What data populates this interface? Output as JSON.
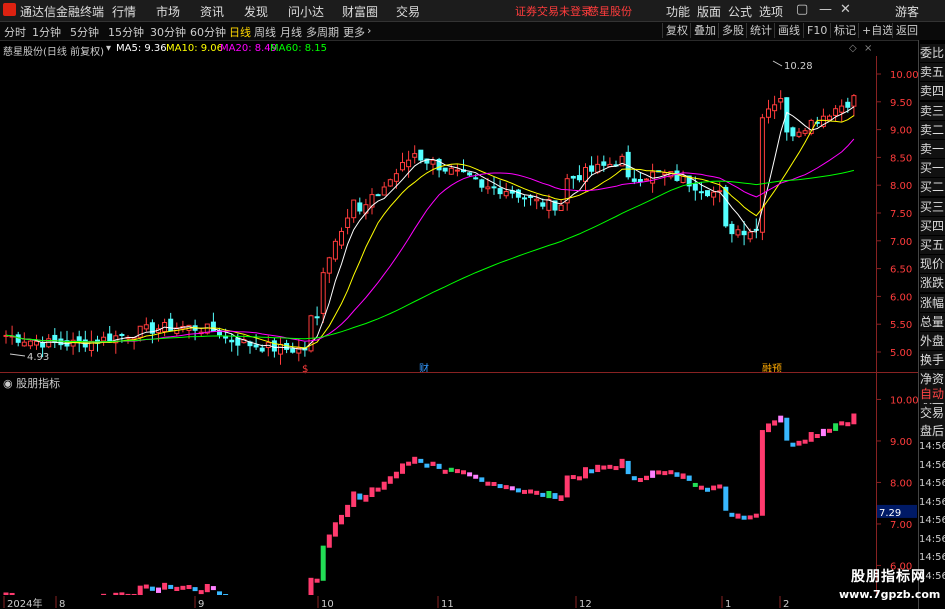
{
  "titlebar": {
    "app_name": "通达信金融终端",
    "menus": [
      "行情",
      "市场",
      "资讯",
      "发现",
      "问小达",
      "财富圈",
      "交易"
    ],
    "trade_notice": "证券交易未登录",
    "stock_name": "慈星股份",
    "right_menus": [
      "功能",
      "版面",
      "公式",
      "选项"
    ],
    "guest": "游客"
  },
  "toolbar": {
    "periods": [
      "分时",
      "1分钟",
      "5分钟",
      "15分钟",
      "30分钟",
      "60分钟",
      "日线",
      "周线",
      "月线",
      "多周期",
      "更多"
    ],
    "active_period": "日线",
    "right_buttons": [
      "复权",
      "叠加",
      "多股",
      "统计",
      "画线",
      "F10",
      "标记",
      "+自选",
      "返回"
    ]
  },
  "main_info": {
    "title": "慈星股份(日线 前复权)",
    "ma5": "MA5: 9.36",
    "ma10": "MA10: 9.06",
    "ma20": "MA20: 8.49",
    "ma60": "MA60: 8.15",
    "high_label": "10.28",
    "low_label": "4.93",
    "event_marks": [
      "$",
      "财",
      "融预"
    ]
  },
  "sub_info": {
    "title": "股朋指标"
  },
  "main_axis": [
    "10.00",
    "9.50",
    "9.00",
    "8.50",
    "8.00",
    "7.50",
    "7.00",
    "6.50",
    "6.00",
    "5.50",
    "5.00"
  ],
  "sub_axis": [
    "10.00",
    "9.00",
    "8.00",
    "7.00",
    "6.00"
  ],
  "sub_axis_highlight": "7.29",
  "date_axis": [
    "2024年",
    "8",
    "9",
    "10",
    "11",
    "12",
    "1",
    "2"
  ],
  "sidebar": {
    "buttons_top": [
      "委比",
      "卖五",
      "卖四",
      "卖三",
      "卖二",
      "卖一",
      "买一",
      "买二",
      "买三",
      "买四",
      "买五",
      "现价",
      "涨跌",
      "涨幅",
      "总量",
      "外盘",
      "换手",
      "净资",
      "收益"
    ],
    "button_auto": "自动",
    "buttons_mid": [
      "交易",
      "盘后"
    ],
    "times": [
      "14:56",
      "14:56",
      "14:56",
      "14:56",
      "14:56",
      "14:56",
      "14:56",
      "14:56"
    ]
  },
  "watermark": {
    "line1": "股朋指标网",
    "line2": "www.7gpzb.com"
  },
  "colors": {
    "up": "#ff3c3c",
    "down": "#54ffff",
    "ma5": "#ffffff",
    "ma10": "#ffff00",
    "ma20": "#ff00ff",
    "ma60": "#00ff00",
    "sub_up": "#ff3a6e",
    "sub_down": "#38b8ff",
    "sub_pink": "#ff80ff",
    "sub_green": "#22dd55"
  }
}
